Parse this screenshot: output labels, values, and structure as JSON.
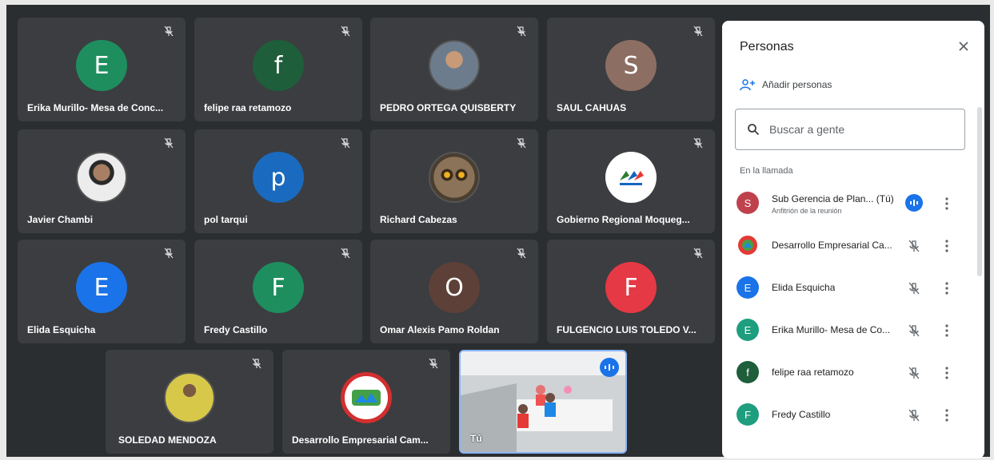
{
  "tiles": [
    {
      "name": "Erika Murillo- Mesa de Conc...",
      "initial": "E",
      "color": "#1e8e5e"
    },
    {
      "name": "felipe raa retamozo",
      "initial": "f",
      "color": "#1e5e3a"
    },
    {
      "name": "PEDRO ORTEGA QUISBERTY",
      "initial": "",
      "color": "#8a7a6a"
    },
    {
      "name": "SAUL CAHUAS",
      "initial": "S",
      "color": "#8d6e63"
    },
    {
      "name": "Javier Chambi",
      "initial": "",
      "color": "#d7ccc8"
    },
    {
      "name": "pol tarqui",
      "initial": "p",
      "color": "#1a6bbf"
    },
    {
      "name": "Richard Cabezas",
      "initial": "",
      "color": "#4e4a3e"
    },
    {
      "name": "Gobierno Regional Moqueg...",
      "initial": "",
      "color": "#ffffff"
    },
    {
      "name": "Elida Esquicha",
      "initial": "E",
      "color": "#1a73e8"
    },
    {
      "name": "Fredy Castillo",
      "initial": "F",
      "color": "#1e8e5e"
    },
    {
      "name": "Omar Alexis Pamo Roldan",
      "initial": "O",
      "color": "#5d4037"
    },
    {
      "name": "FULGENCIO LUIS TOLEDO V...",
      "initial": "F",
      "color": "#e53945"
    },
    {
      "name": "SOLEDAD MENDOZA",
      "initial": "",
      "color": "#c9b64a"
    },
    {
      "name": "Desarrollo Empresarial Cam...",
      "initial": "",
      "color": "#ffffff"
    },
    {
      "name": "Tú",
      "initial": "",
      "color": "#d0d4d6"
    }
  ],
  "panel": {
    "title": "Personas",
    "add_people": "Añadir personas",
    "search_placeholder": "Buscar a gente",
    "section": "En la llamada",
    "people": [
      {
        "name": "Sub Gerencia de Plan... (Tú)",
        "sub": "Anfitrión de la reunión",
        "initial": "S",
        "color": "#c0414e"
      },
      {
        "name": "Desarrollo Empresarial Ca...",
        "sub": "",
        "initial": "",
        "color": "#e53945"
      },
      {
        "name": "Elida Esquicha",
        "sub": "",
        "initial": "E",
        "color": "#1a73e8"
      },
      {
        "name": "Erika Murillo- Mesa de Co...",
        "sub": "",
        "initial": "E",
        "color": "#1e9e7e"
      },
      {
        "name": "felipe raa retamozo",
        "sub": "",
        "initial": "f",
        "color": "#1e5e3a"
      },
      {
        "name": "Fredy Castillo",
        "sub": "",
        "initial": "F",
        "color": "#1e9e7e"
      }
    ]
  },
  "icons": {
    "mute": "mic-off-icon",
    "close": "close-icon",
    "add": "add-person-icon",
    "search": "search-icon",
    "more": "more-vert-icon",
    "speaking": "speaking-icon"
  }
}
